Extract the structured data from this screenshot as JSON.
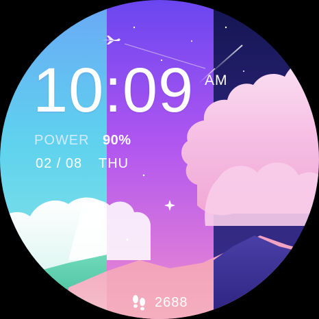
{
  "watchface": {
    "time": "10:09",
    "ampm": "AM",
    "power_label": "POWER",
    "power_value": "90%",
    "date": "02 / 08",
    "weekday": "THU",
    "steps": "2688",
    "steps_icon": "footprints-icon",
    "colors": {
      "panel_left": "#6fc8f2",
      "panel_middle": "#a35cf0",
      "panel_right": "#2a2470",
      "text": "#ffffff",
      "power_label": "#d6e9ff"
    }
  }
}
